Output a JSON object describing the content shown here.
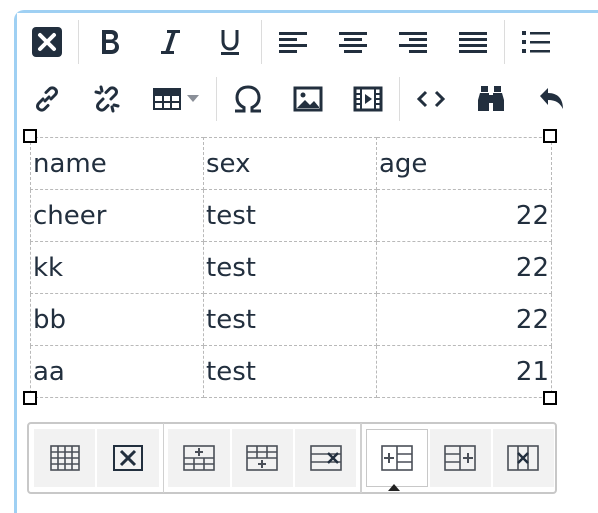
{
  "toolbar": {
    "row1": [
      "clear-formatting",
      "bold",
      "italic",
      "underline",
      "align-left",
      "align-center",
      "align-right",
      "align-justify",
      "bullet-list"
    ],
    "row2": [
      "link",
      "unlink",
      "table",
      "special-character",
      "image",
      "media",
      "source-code",
      "find-replace",
      "undo"
    ]
  },
  "table": {
    "rows": [
      [
        "name",
        "sex",
        "age"
      ],
      [
        "cheer",
        "test",
        "22"
      ],
      [
        "kk",
        "test",
        "22"
      ],
      [
        "bb",
        "test",
        "22"
      ],
      [
        "aa",
        "test",
        "21"
      ]
    ]
  },
  "table_toolbar": {
    "buttons": [
      "table-properties",
      "delete-table",
      "insert-row-before",
      "insert-row-after",
      "delete-row",
      "insert-column-before",
      "insert-column-after",
      "delete-column"
    ],
    "active": "insert-column-before"
  },
  "colors": {
    "focus_border": "#9fd0f3",
    "icon": "#222f3e",
    "cell_border": "#b9b9b9"
  }
}
